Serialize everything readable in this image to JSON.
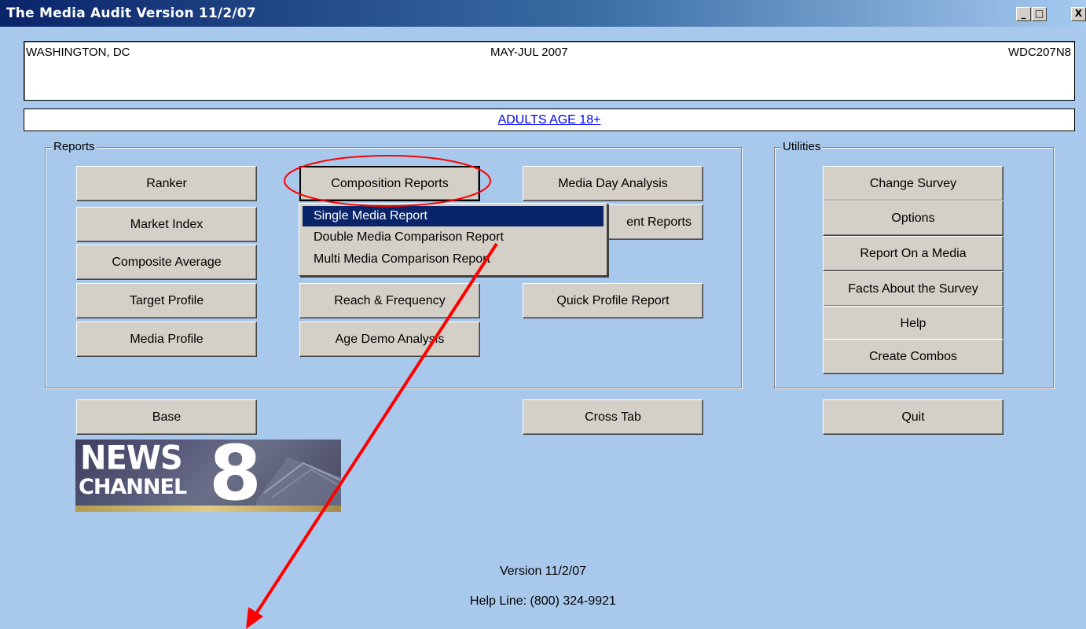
{
  "window": {
    "title": "The Media Audit  Version 11/2/07",
    "controls": {
      "minimize": "_",
      "maximize": "□",
      "close": "X"
    }
  },
  "header": {
    "market": "WASHINGTON, DC",
    "period": "MAY-JUL 2007",
    "code": "WDC207N8"
  },
  "demographic": "ADULTS AGE 18+",
  "reports": {
    "label": "Reports",
    "buttons": {
      "ranker": "Ranker",
      "market_index": "Market Index",
      "composite_average": "Composite Average",
      "target_profile": "Target Profile",
      "media_profile": "Media Profile",
      "composition_reports": "Composition Reports",
      "reach_frequency": "Reach & Frequency",
      "age_demo_analysis": "Age Demo Analysis",
      "media_day_analysis": "Media Day Analysis",
      "hidden_partial": "ent Reports",
      "quick_profile_report": "Quick Profile Report"
    }
  },
  "composition_menu": {
    "items": [
      "Single Media Report",
      "Double Media Comparison Report",
      "Multi Media Comparison Report"
    ],
    "selected": "Single Media Report"
  },
  "utilities": {
    "label": "Utilities",
    "buttons": {
      "change_survey": "Change Survey",
      "options": "Options",
      "report_on_media": "Report On a Media",
      "facts_about_survey": "Facts About the Survey",
      "help": "Help",
      "create_combos": "Create Combos"
    }
  },
  "bottom_buttons": {
    "base": "Base",
    "cross_tab": "Cross Tab",
    "quit": "Quit"
  },
  "logo": {
    "line1": "NEWS",
    "line2": "CHANNEL",
    "number": "8"
  },
  "footer": {
    "version": "Version 11/2/07",
    "helpline": "Help Line: (800) 324-9921"
  },
  "colors": {
    "background": "#a9c9ec",
    "annotation": "#ff0000",
    "menu_selection": "#0a246a"
  }
}
